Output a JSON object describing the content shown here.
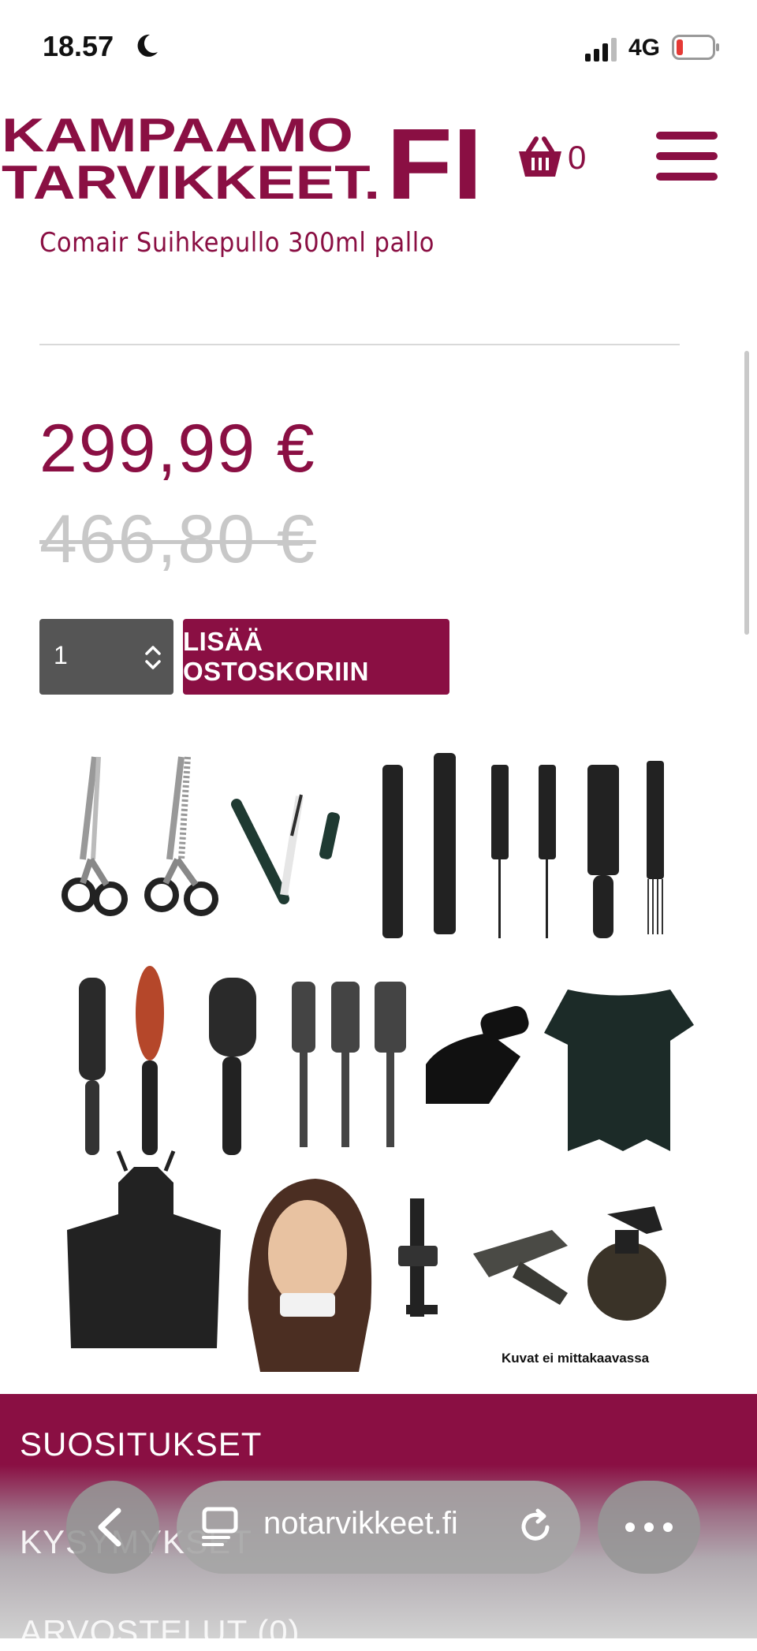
{
  "status_bar": {
    "time": "18.57",
    "network": "4G",
    "icons": [
      "moon-icon",
      "signal-icon",
      "battery-icon"
    ]
  },
  "header": {
    "logo_line1": "KAMPAAMO",
    "logo_line2": "TARVIKKEET.",
    "logo_suffix": "FI",
    "cart_count": "0",
    "icons": [
      "basket-icon",
      "hamburger-menu-icon"
    ]
  },
  "product": {
    "title": "Comair Suihkepullo 300ml pallo",
    "price": "299,99 €",
    "old_price": "466,80 €",
    "quantity": "1",
    "add_to_cart_label": "LISÄÄ OSTOSKORIIN",
    "image_caption": "Kuvat ei mittakaavassa"
  },
  "tabs": [
    {
      "label": "SUOSITUKSET"
    },
    {
      "label": "KYSYMYKSET"
    },
    {
      "label": "ARVOSTELUT (0)"
    }
  ],
  "browser_bar": {
    "url": "notarvikkeet.fi",
    "icons": [
      "back-arrow-icon",
      "tabs-icon",
      "reload-icon",
      "more-icon"
    ]
  },
  "colors": {
    "brand": "#8a0f43",
    "qty_background": "#555555",
    "old_price": "#c8c8c8"
  }
}
